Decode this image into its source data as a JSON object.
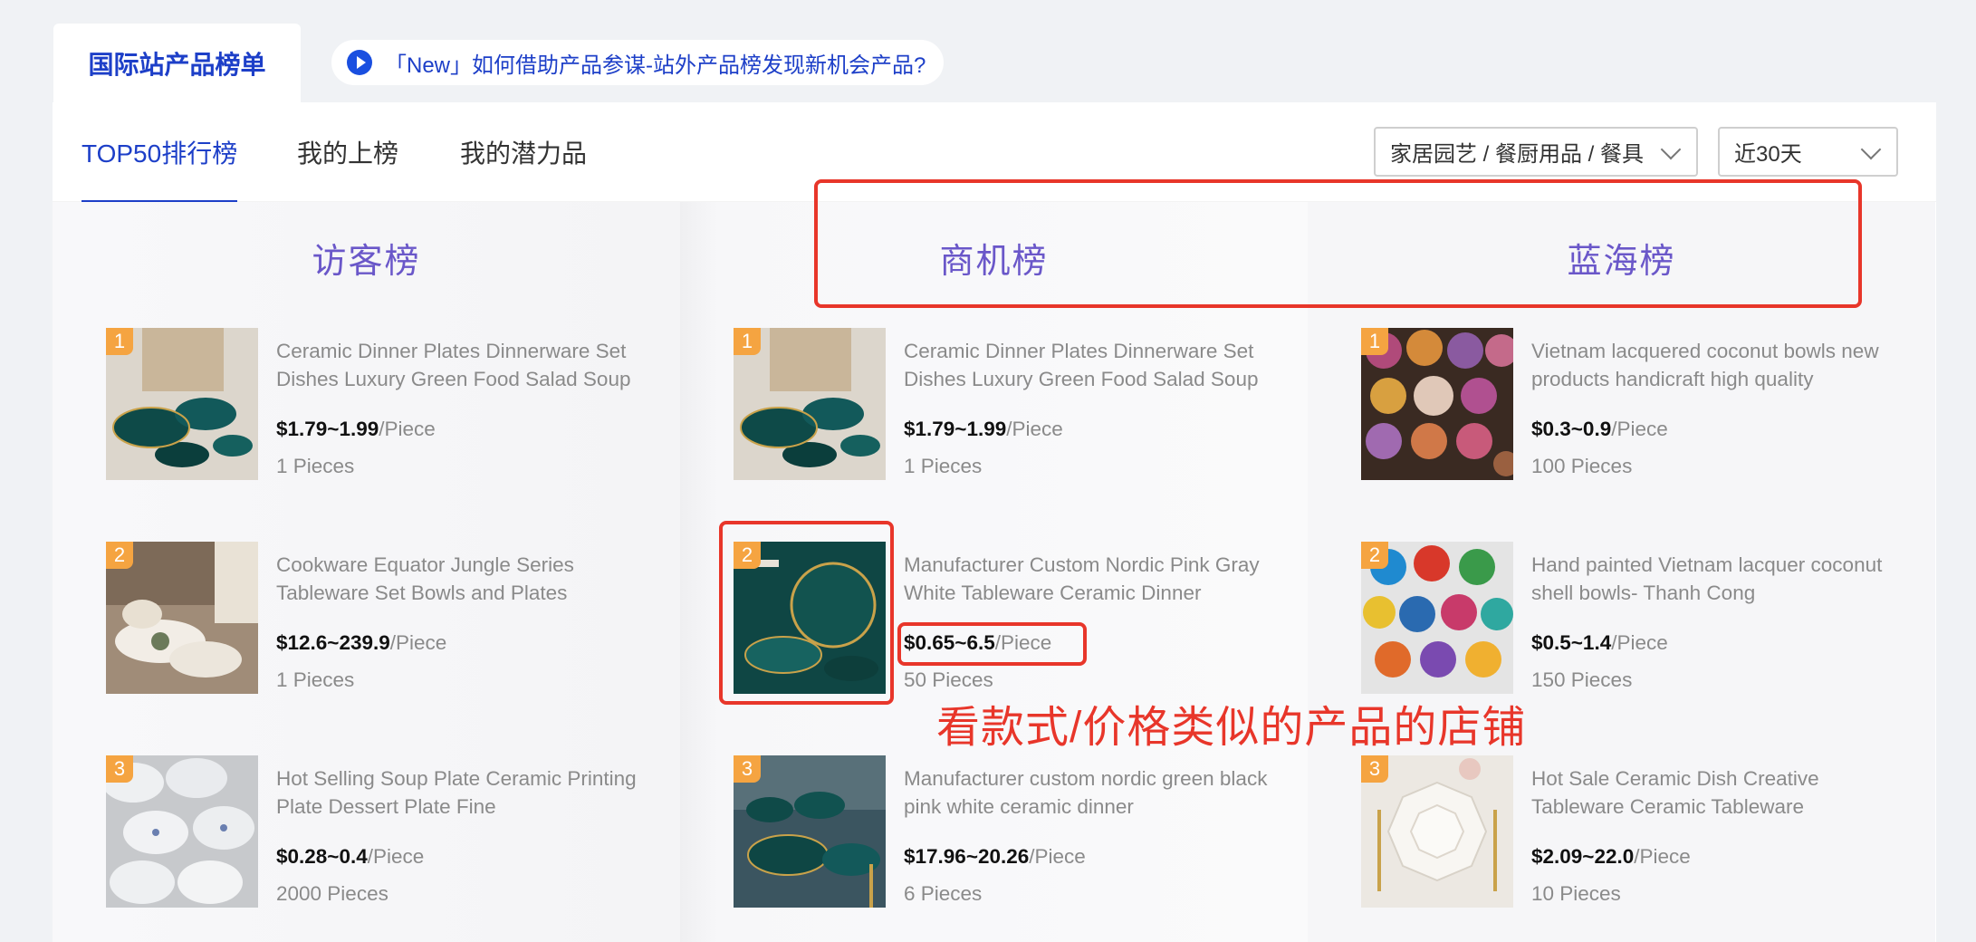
{
  "header": {
    "tab_label": "国际站产品榜单",
    "notice_text": "「New」如何借助产品参谋-站外产品榜发现新机会产品?"
  },
  "subtabs": [
    {
      "label": "TOP50排行榜",
      "active": true
    },
    {
      "label": "我的上榜",
      "active": false
    },
    {
      "label": "我的潜力品",
      "active": false
    }
  ],
  "filters": {
    "category": "家居园艺 / 餐厨用品 / 餐具",
    "period": "近30天"
  },
  "columns": [
    {
      "title": "访客榜",
      "items": [
        {
          "rank": "1",
          "title": "Ceramic Dinner Plates Dinnerware Set Dishes Luxury Green Food Salad Soup",
          "price": "$1.79~1.99",
          "unit": "/Piece",
          "moq": "1 Pieces"
        },
        {
          "rank": "2",
          "title": "Cookware Equator Jungle Series Tableware Set Bowls and Plates",
          "price": "$12.6~239.9",
          "unit": "/Piece",
          "moq": "1 Pieces"
        },
        {
          "rank": "3",
          "title": "Hot Selling Soup Plate Ceramic Printing Plate Dessert Plate Fine",
          "price": "$0.28~0.4",
          "unit": "/Piece",
          "moq": "2000 Pieces"
        }
      ]
    },
    {
      "title": "商机榜",
      "items": [
        {
          "rank": "1",
          "title": "Ceramic Dinner Plates Dinnerware Set Dishes Luxury Green Food Salad Soup",
          "price": "$1.79~1.99",
          "unit": "/Piece",
          "moq": "1 Pieces"
        },
        {
          "rank": "2",
          "title": "Manufacturer Custom Nordic Pink Gray White Tableware Ceramic Dinner",
          "price": "$0.65~6.5",
          "unit": "/Piece",
          "moq": "50 Pieces"
        },
        {
          "rank": "3",
          "title": "Manufacturer custom nordic green black pink white ceramic dinner",
          "price": "$17.96~20.26",
          "unit": "/Piece",
          "moq": "6 Pieces"
        }
      ]
    },
    {
      "title": "蓝海榜",
      "items": [
        {
          "rank": "1",
          "title": "Vietnam lacquered coconut bowls new products handicraft high quality",
          "price": "$0.3~0.9",
          "unit": "/Piece",
          "moq": "100 Pieces"
        },
        {
          "rank": "2",
          "title": "Hand painted Vietnam lacquer coconut shell bowls- Thanh Cong",
          "price": "$0.5~1.4",
          "unit": "/Piece",
          "moq": "150 Pieces"
        },
        {
          "rank": "3",
          "title": "Hot Sale Ceramic Dish Creative Tableware Ceramic Tableware",
          "price": "$2.09~22.0",
          "unit": "/Piece",
          "moq": "10 Pieces"
        }
      ]
    }
  ],
  "annotation": {
    "text": "看款式/价格类似的产品的店铺",
    "color": "#e8362a"
  },
  "colors": {
    "brand_blue": "#1d3fc8",
    "column_title": "#6a57c9",
    "rank_badge": "#f5a441"
  }
}
